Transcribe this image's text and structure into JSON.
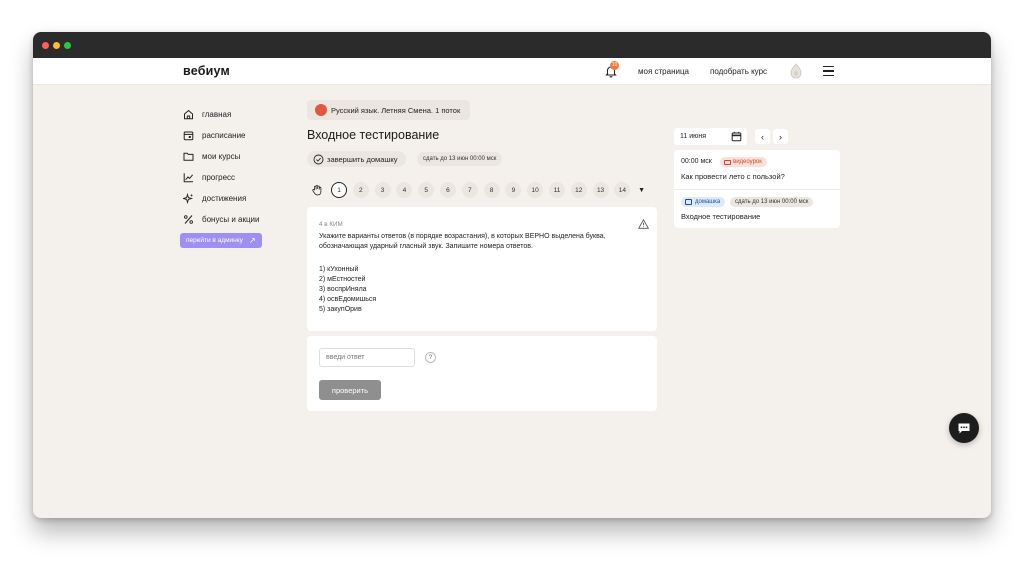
{
  "app": {
    "logo": "вебиум",
    "notification_count": "10",
    "nav": {
      "my_page": "моя страница",
      "pick_course": "подобрать курс"
    }
  },
  "sidebar": {
    "items": [
      {
        "label": "главная",
        "icon": "home-icon"
      },
      {
        "label": "расписание",
        "icon": "calendar-icon"
      },
      {
        "label": "мои курсы",
        "icon": "folder-icon"
      },
      {
        "label": "прогресс",
        "icon": "chart-icon"
      },
      {
        "label": "достижения",
        "icon": "sparkle-icon"
      },
      {
        "label": "бонусы и акции",
        "icon": "percent-icon"
      }
    ],
    "admin_button": "перейти в админку"
  },
  "main": {
    "course_chip": "Русский язык. Летняя Смена. 1 поток",
    "title": "Входное тестирование",
    "finish_button": "завершить домашку",
    "deadline": "сдать до 13 июн 00:00 мск",
    "questions": [
      "1",
      "2",
      "3",
      "4",
      "5",
      "6",
      "7",
      "8",
      "9",
      "10",
      "11",
      "12",
      "13",
      "14"
    ],
    "active_question": "1",
    "question": {
      "meta": "4 в КИМ",
      "text": "Укажите варианты ответов (в порядке возрастания), в которых ВЕРНО выделена буква, обозначающая ударный гласный звук. Запишите номера ответов.",
      "options": [
        "1) кУхонный",
        "2) мЕстностей",
        "3) воспрИняла",
        "4) освЕдомишься",
        "5) закупОрив"
      ]
    },
    "answer": {
      "placeholder": "введи ответ",
      "help": "?",
      "check_button": "проверить"
    }
  },
  "schedule": {
    "date": "11 июня",
    "prev": "‹",
    "next": "›",
    "lesson": {
      "time": "00:00 мск",
      "badge": "видеоурок",
      "title": "Как провести лето с пользой?",
      "hw_badge": "домашка",
      "hw_due": "сдать до 13 июн 00:00 мск",
      "hw_title": "Входное тестирование"
    }
  },
  "colors": {
    "background": "#f4f1ed",
    "accent_purple": "#9e90f0",
    "notification": "#f07a3c",
    "video_badge": "#fbe1dc",
    "homework_badge": "#dbe9fb"
  }
}
